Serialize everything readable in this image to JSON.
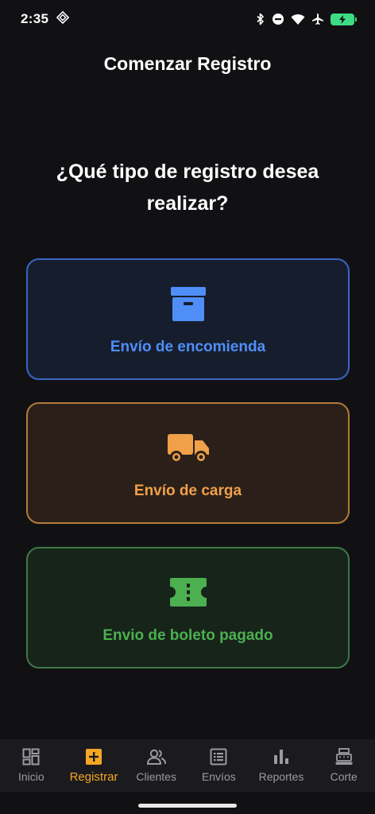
{
  "status_bar": {
    "time": "2:35",
    "icons": [
      "nfc-icon",
      "bluetooth-icon",
      "do-not-disturb-icon",
      "wifi-icon",
      "airplane-icon",
      "battery-charging-icon"
    ],
    "battery_color": "#3ddc84"
  },
  "app_bar": {
    "title": "Comenzar Registro"
  },
  "main": {
    "question": "¿Qué tipo de registro desea realizar?",
    "options": [
      {
        "label": "Envío de encomienda",
        "icon": "archive-box-icon",
        "accent": "#4f8ef7"
      },
      {
        "label": "Envío de carga",
        "icon": "truck-icon",
        "accent": "#f0a048"
      },
      {
        "label": "Envio de boleto pagado",
        "icon": "ticket-icon",
        "accent": "#4caf50"
      }
    ]
  },
  "bottom_nav": {
    "active_color": "#f5a623",
    "items": [
      {
        "label": "Inicio",
        "icon": "dashboard-icon"
      },
      {
        "label": "Registrar",
        "icon": "add-box-icon",
        "active": true
      },
      {
        "label": "Clientes",
        "icon": "people-icon"
      },
      {
        "label": "Envíos",
        "icon": "list-icon"
      },
      {
        "label": "Reportes",
        "icon": "bar-chart-icon"
      },
      {
        "label": "Corte",
        "icon": "cash-register-icon"
      }
    ]
  }
}
